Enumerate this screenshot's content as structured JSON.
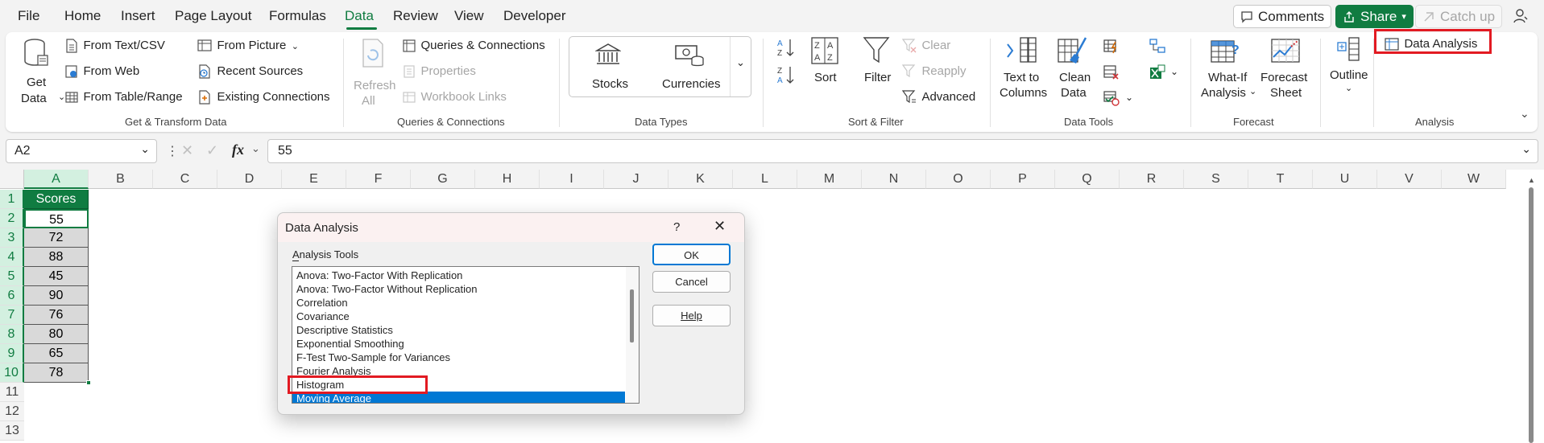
{
  "menu": {
    "tabs": [
      "File",
      "Home",
      "Insert",
      "Page Layout",
      "Formulas",
      "Data",
      "Review",
      "View",
      "Developer"
    ],
    "active_tab": "Data",
    "comments_label": "Comments",
    "share_label": "Share",
    "catchup_label": "Catch up"
  },
  "ribbon": {
    "get_transform": {
      "get_data_top": "Get",
      "get_data_bottom": "Data",
      "from_text_csv": "From Text/CSV",
      "from_web": "From Web",
      "from_table_range": "From Table/Range",
      "from_picture": "From Picture",
      "recent_sources": "Recent Sources",
      "existing_connections": "Existing Connections",
      "label": "Get & Transform Data"
    },
    "queries": {
      "refresh_top": "Refresh",
      "refresh_bottom": "All",
      "queries_connections": "Queries & Connections",
      "properties": "Properties",
      "workbook_links": "Workbook Links",
      "label": "Queries & Connections"
    },
    "data_types": {
      "stocks": "Stocks",
      "currencies": "Currencies",
      "label": "Data Types"
    },
    "sort_filter": {
      "sort": "Sort",
      "filter": "Filter",
      "clear": "Clear",
      "reapply": "Reapply",
      "advanced": "Advanced",
      "label": "Sort & Filter"
    },
    "data_tools": {
      "text_to_top": "Text to",
      "text_to_bottom": "Columns",
      "clean_top": "Clean",
      "clean_bottom": "Data",
      "label": "Data Tools"
    },
    "forecast": {
      "whatif_top": "What-If",
      "whatif_bottom": "Analysis",
      "forecast_top": "Forecast",
      "forecast_bottom": "Sheet",
      "label": "Forecast"
    },
    "outline": {
      "outline": "Outline"
    },
    "analysis": {
      "data_analysis": "Data Analysis",
      "label": "Analysis"
    }
  },
  "formula_bar": {
    "name_box": "A2",
    "fx": "fx",
    "value": "55"
  },
  "grid": {
    "columns": [
      "A",
      "B",
      "C",
      "D",
      "E",
      "F",
      "G",
      "H",
      "I",
      "J",
      "K",
      "L",
      "M",
      "N",
      "O",
      "P",
      "Q",
      "R",
      "S",
      "T",
      "U",
      "V",
      "W"
    ],
    "rows": [
      "1",
      "2",
      "3",
      "4",
      "5",
      "6",
      "7",
      "8",
      "9",
      "10",
      "11",
      "12",
      "13"
    ],
    "header_cell": "Scores",
    "scores": [
      "55",
      "72",
      "88",
      "45",
      "90",
      "76",
      "80",
      "65",
      "78"
    ]
  },
  "dialog": {
    "title": "Data Analysis",
    "help_glyph": "?",
    "tools_label": "Analysis Tools",
    "items": [
      "Anova: Two-Factor With Replication",
      "Anova: Two-Factor Without Replication",
      "Correlation",
      "Covariance",
      "Descriptive Statistics",
      "Exponential Smoothing",
      "F-Test Two-Sample for Variances",
      "Fourier Analysis",
      "Histogram",
      "Moving Average"
    ],
    "selected_item": "Moving Average",
    "ok_label": "OK",
    "cancel_label": "Cancel",
    "help_label": "Help"
  },
  "colors": {
    "accent": "#107c41",
    "highlight": "#e21a22",
    "selection": "#0078d4"
  }
}
